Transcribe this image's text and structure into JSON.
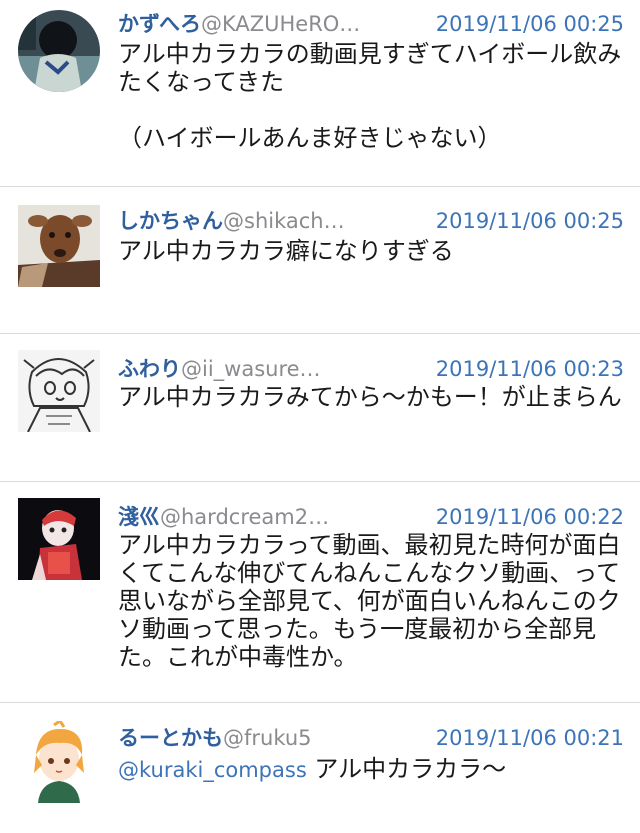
{
  "tweets": [
    {
      "name": "かずへろ",
      "handle": "@KAZUHeRO…",
      "time": "2019/11/06 00:25",
      "text": "アル中カラカラの動画見すぎてハイボール飲みたくなってきた\n\n（ハイボールあんま好きじゃない）",
      "avatar": "avatar-photo-dark"
    },
    {
      "name": "しかちゃん",
      "handle": "@shikach…",
      "time": "2019/11/06 00:25",
      "text": "アル中カラカラ癖になりすぎる",
      "avatar": "avatar-deer"
    },
    {
      "name": "ふわり",
      "handle": "@ii_wasure…",
      "time": "2019/11/06 00:23",
      "text": "アル中カラカラみてから〜かもー！が止まらん",
      "avatar": "avatar-sketch"
    },
    {
      "name": "淺巛",
      "handle": "@hardcream2…",
      "time": "2019/11/06 00:22",
      "text": "アル中カラカラって動画、最初見た時何が面白くてこんな伸びてんねんこんなクソ動画、って思いながら全部見て、何が面白いんねんこのクソ動画って思った。もう一度最初から全部見た。これが中毒性か。",
      "avatar": "avatar-red-character"
    },
    {
      "name": "るーとかも",
      "handle": "@fruku5",
      "time": "2019/11/06 00:21",
      "mention": "@kuraki_compass",
      "text": " アル中カラカラ〜",
      "avatar": "avatar-orange-hair-character"
    }
  ],
  "colors": {
    "name": "#2f5f9e",
    "handle": "#8a8a8f",
    "time": "#3d74b8",
    "separator": "#d9d9de"
  }
}
